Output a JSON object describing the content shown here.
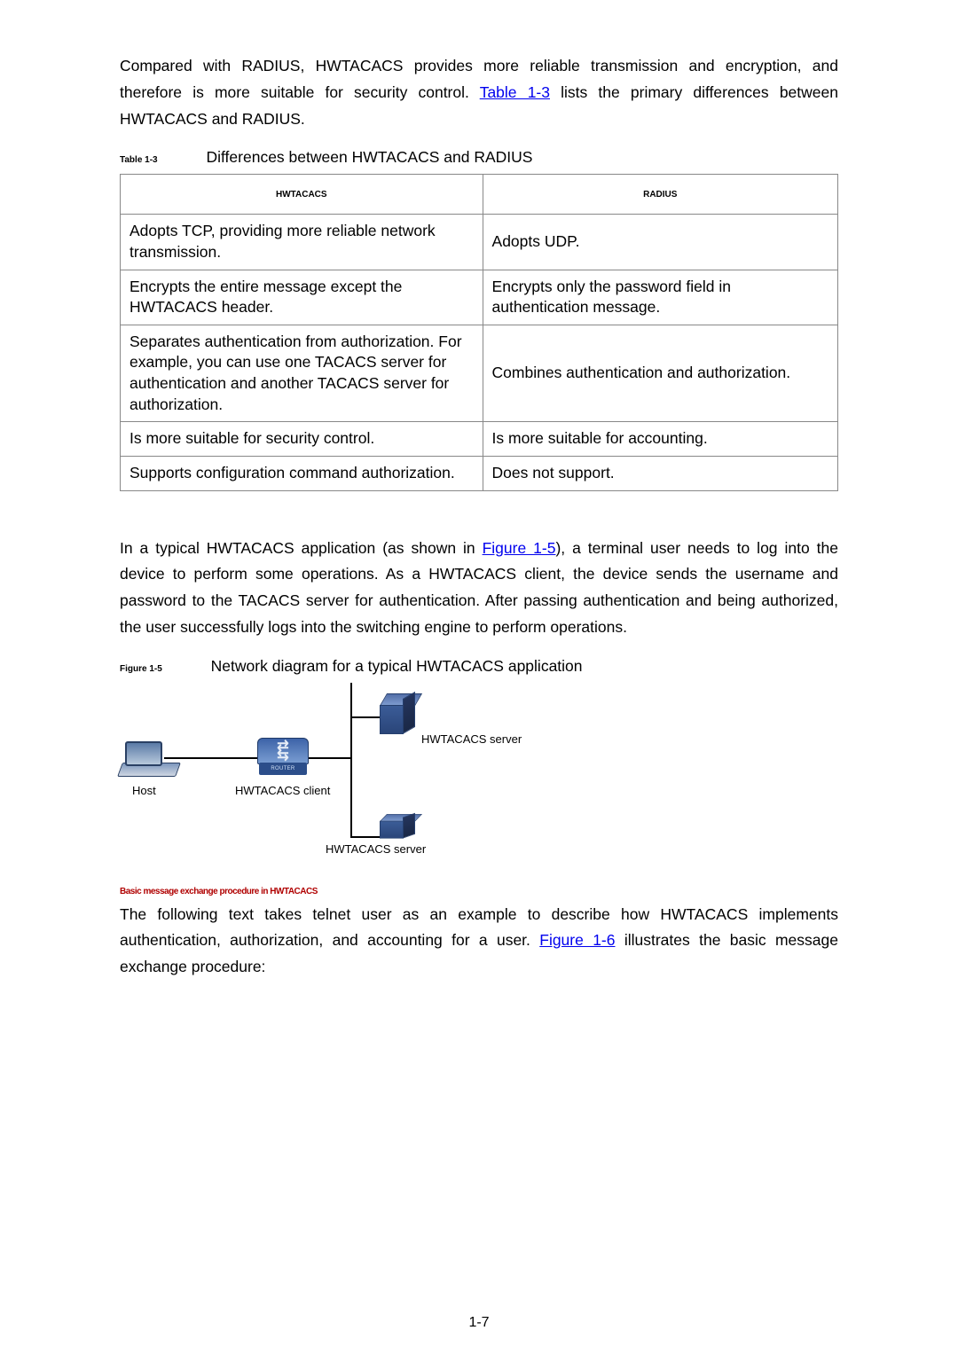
{
  "intro": {
    "para1_pre": "Compared with RADIUS, HWTACACS provides more reliable transmission and encryption, and therefore is more suitable for security control. ",
    "table_link": "Table 1-3",
    "para1_post": " lists the primary differences between HWTACACS and RADIUS."
  },
  "table_caption": {
    "num": "Table 1-3",
    "text": "Differences between HWTACACS and RADIUS"
  },
  "table": {
    "headers": {
      "col1": "HWTACACS",
      "col2": "RADIUS"
    },
    "rows": [
      {
        "c1": "Adopts TCP, providing more reliable network transmission.",
        "c2": "Adopts UDP."
      },
      {
        "c1": "Encrypts the entire message except the HWTACACS header.",
        "c2": "Encrypts only the password field in authentication message."
      },
      {
        "c1": "Separates authentication from authorization. For example, you can use one TACACS server for authentication and another TACACS server for authorization.",
        "c2": "Combines authentication and authorization."
      },
      {
        "c1": "Is more suitable for security control.",
        "c2": "Is more suitable for accounting."
      },
      {
        "c1": "Supports configuration command authorization.",
        "c2": "Does not support."
      }
    ]
  },
  "mid": {
    "para_pre": "In a typical HWTACACS application (as shown in ",
    "fig_link": "Figure 1-5",
    "para_post": "), a terminal user needs to log into the device to perform some operations. As a HWTACACS client, the device sends the username and password to the TACACS server for authentication. After passing authentication and being authorized, the user successfully logs into the switching engine to perform operations."
  },
  "figure_caption": {
    "num": "Figure 1-5",
    "text": "Network diagram for a typical HWTACACS application"
  },
  "diagram": {
    "host_label": "Host",
    "client_label": "HWTACACS client",
    "router_badge": "ROUTER",
    "server1_label": "HWTACACS server",
    "server2_label": "HWTACACS server"
  },
  "section_heading": "Basic message exchange procedure in HWTACACS",
  "tail": {
    "para_pre": "The following text takes telnet user as an example to describe how HWTACACS implements authentication, authorization, and accounting for a user. ",
    "fig_link": "Figure 1-6",
    "para_post": " illustrates the basic message exchange procedure:"
  },
  "page_number": "1-7"
}
